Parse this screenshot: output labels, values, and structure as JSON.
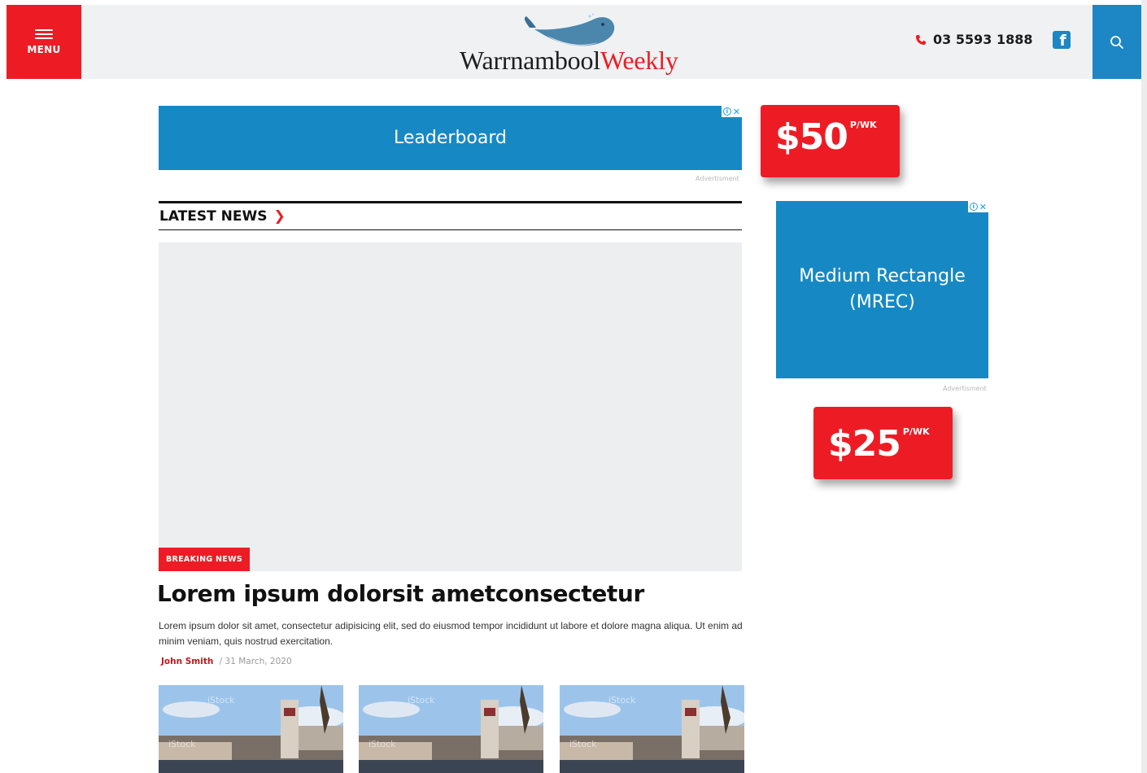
{
  "header": {
    "menu_label": "MENU",
    "logo_part1": "Warrnambool",
    "logo_part2": "Weekly",
    "phone": "03 5593 1888",
    "facebook_glyph": "f",
    "icons": {
      "menu": "hamburger-icon",
      "phone": "phone-icon",
      "facebook": "facebook-icon",
      "search": "search-icon",
      "logo": "whale-logo-icon"
    }
  },
  "ads": {
    "leaderboard_label": "Leaderboard",
    "leaderboard_caption": "Advertisment",
    "leaderboard_price": "$50",
    "leaderboard_price_unit": "P/WK",
    "mrec_label_line1": "Medium Rectangle",
    "mrec_label_line2": "(MREC)",
    "mrec_caption": "Advertisment",
    "mrec_price": "$25",
    "mrec_price_unit": "P/WK",
    "adchoice_info": "i",
    "adchoice_close": "✕"
  },
  "section": {
    "title": "LATEST NEWS",
    "chevron": "❯"
  },
  "hero": {
    "badge": "BREAKING NEWS",
    "title": "Lorem ipsum dolorsit ametconsectetur",
    "excerpt": "Lorem ipsum dolor sit amet, consectetur adipisicing elit, sed do eiusmod tempor incididunt ut labore et dolore magna aliqua. Ut enim ad minim veniam, quis nostrud exercitation.",
    "author": "John Smith",
    "date": "/ 31 March, 2020"
  },
  "thumbnails": [
    {
      "watermark": "iStock"
    },
    {
      "watermark": "iStock"
    },
    {
      "watermark": "iStock"
    }
  ],
  "colors": {
    "brand_red": "#ed1c24",
    "brand_blue": "#1689c4",
    "header_bg": "#eff1f2"
  }
}
